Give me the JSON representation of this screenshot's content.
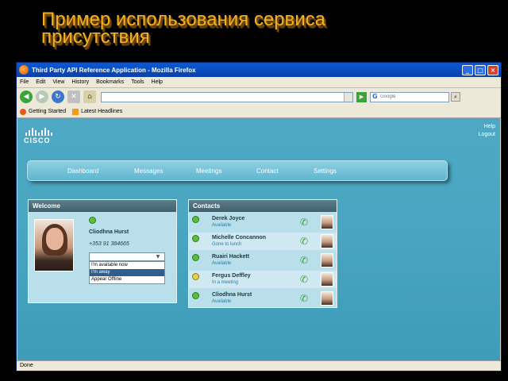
{
  "slide_title": "Пример использования сервиса присутствия",
  "browser": {
    "title": "Third Party API Reference Application - Mozilla Firefox",
    "menu": [
      "File",
      "Edit",
      "View",
      "History",
      "Bookmarks",
      "Tools",
      "Help"
    ],
    "search_placeholder": "Google",
    "bookmarks": [
      "Getting Started",
      "Latest Headlines"
    ],
    "status": "Done"
  },
  "app": {
    "logo_text": "CISCO",
    "top_links": [
      "Help",
      "Logout"
    ],
    "nav": [
      "Dashboard",
      "Messages",
      "Meetings",
      "Contact",
      "Settings"
    ],
    "welcome": {
      "header": "Welcome",
      "name": "Cliodhna Hurst",
      "phone": "+353 91 384665",
      "status_options": [
        "I'm available now",
        "I'm away",
        "Appear Offline"
      ],
      "selected_status_index": 1
    },
    "contacts": {
      "header": "Contacts",
      "items": [
        {
          "name": "Derek Joyce",
          "status": "Available",
          "state": "available"
        },
        {
          "name": "Michelle Concannon",
          "status": "Gone to lunch",
          "state": "available"
        },
        {
          "name": "Ruairi Hackett",
          "status": "Available",
          "state": "available"
        },
        {
          "name": "Fergus Deffley",
          "status": "In a meeting",
          "state": "busy"
        },
        {
          "name": "Cliodhna Hurst",
          "status": "Available",
          "state": "available"
        }
      ]
    }
  }
}
